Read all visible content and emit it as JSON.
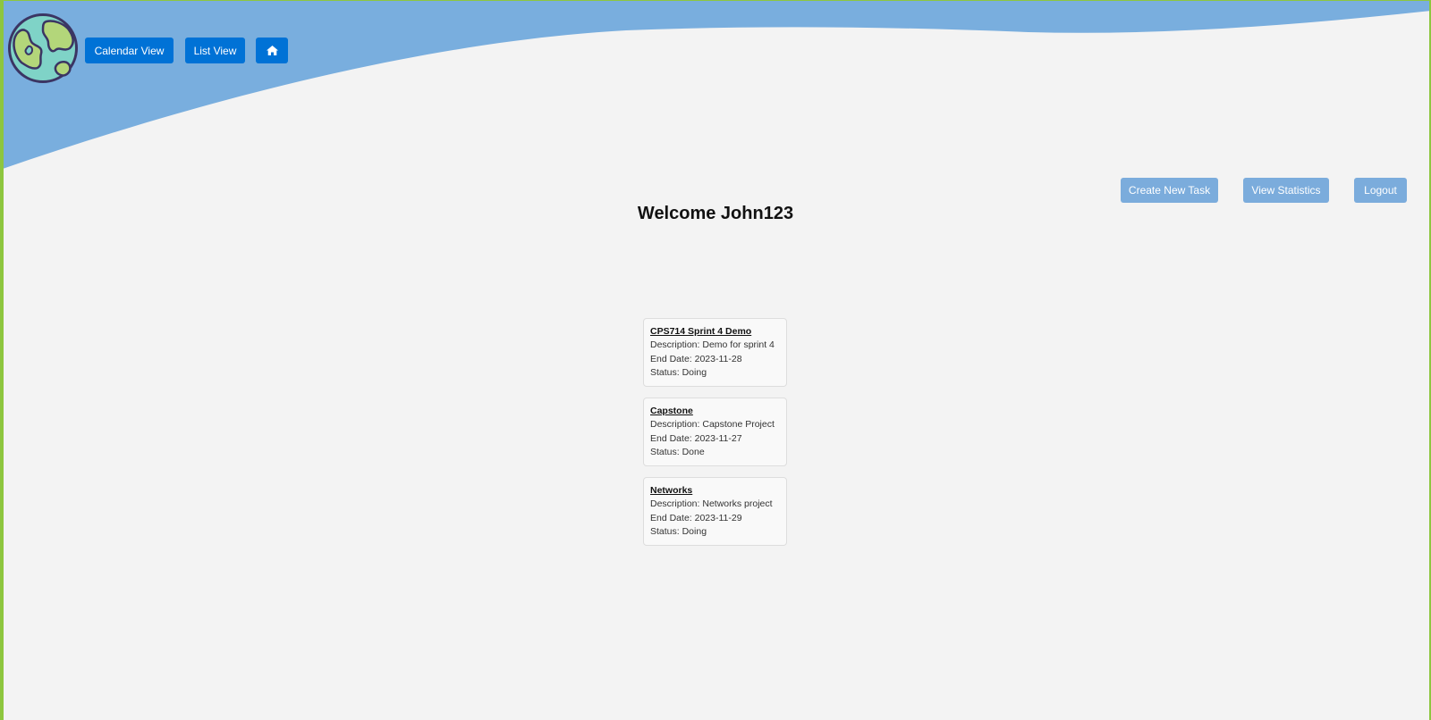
{
  "header": {
    "nav": {
      "calendar_view_label": "Calendar View",
      "list_view_label": "List View",
      "home_icon": "home-icon"
    },
    "logo_icon": "globe-icon"
  },
  "actions": {
    "create_task_label": "Create New Task",
    "view_statistics_label": "View Statistics",
    "logout_label": "Logout"
  },
  "welcome": {
    "text": "Welcome John123"
  },
  "tasks": [
    {
      "title": "CPS714 Sprint 4 Demo",
      "description": "Description: Demo for sprint 4",
      "end_date": "End Date: 2023-11-28",
      "status": "Status: Doing"
    },
    {
      "title": "Capstone",
      "description": "Description: Capstone Project",
      "end_date": "End Date: 2023-11-27",
      "status": "Status: Done"
    },
    {
      "title": "Networks",
      "description": "Description: Networks project",
      "end_date": "End Date: 2023-11-29",
      "status": "Status: Doing"
    }
  ],
  "colors": {
    "header_wave": "#79aede",
    "primary_button": "#0072d6",
    "secondary_button": "#7bacdc",
    "background": "#f3f3f3",
    "border_accent": "#8dc63f",
    "globe_ocean": "#7fd3c7",
    "globe_land": "#b3d67a"
  }
}
